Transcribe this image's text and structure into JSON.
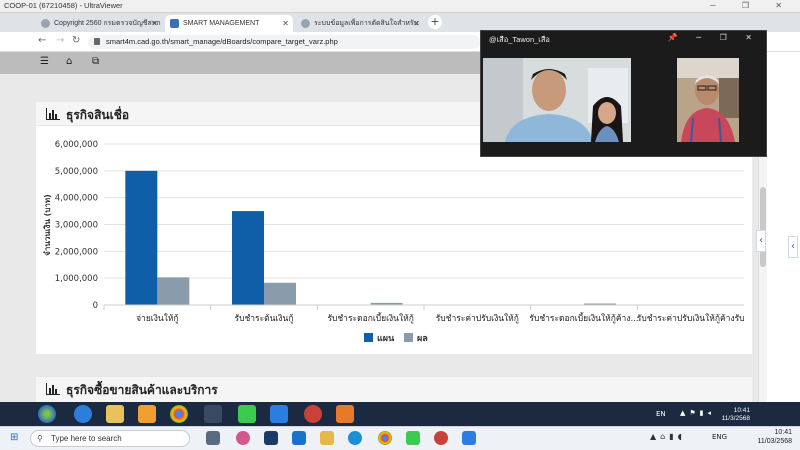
{
  "ultraviewer": {
    "title": "COOP-01 (67210458) - UltraViewer",
    "controls": "─ ❐ ✕"
  },
  "browser": {
    "tabs": [
      {
        "label": "Copyright 2560 กรมตรวจบัญชีสหก",
        "active": false
      },
      {
        "label": "SMART MANAGEMENT",
        "active": true
      },
      {
        "label": "ระบบข้อมูลเพื่อการตัดสินใจสำหรับ",
        "active": false
      }
    ],
    "new_tab": "+",
    "url": "smart4m.cad.go.th/smart_manage/dBoards/compare_target_varz.php"
  },
  "page": {
    "section1_title": "ธุรกิจสินเชื่อ",
    "section2_title": "ธุรกิจซื้อขายสินค้าและบริการ"
  },
  "video_call": {
    "title": "@เสือ_Tawon_เสือ",
    "controls": "📌 ─ ❐ ✕"
  },
  "chart_data": {
    "type": "bar",
    "title": "",
    "ylabel": "จำนวนเงิน (บาท)",
    "xlabel": "",
    "ylim": [
      0,
      6000000
    ],
    "yticks": [
      "0",
      "1,000,000",
      "2,000,000",
      "3,000,000",
      "4,000,000",
      "5,000,000",
      "6,000,000"
    ],
    "categories": [
      "จ่ายเงินให้กู้",
      "รับชำระต้นเงินกู้",
      "รับชำระดอกเบี้ยเงินให้กู้",
      "รับชำระค่าปรับเงินให้กู้",
      "รับชำระดอกเบี้ยเงินให้กู้ค้าง...",
      "รับชำระค่าปรับเงินให้กู้ค้างรับ"
    ],
    "series": [
      {
        "name": "แผน",
        "color": "#0f5fa8",
        "values": [
          5000000,
          3500000,
          0,
          0,
          0,
          0
        ]
      },
      {
        "name": "ผล",
        "color": "#8a9bab",
        "values": [
          1030000,
          830000,
          80000,
          0,
          20000,
          0
        ]
      }
    ],
    "legend": "bottom",
    "grid": true
  },
  "win_taskbar": {
    "lang": "EN",
    "time": "10:41",
    "date": "11/3/2568"
  },
  "host_taskbar": {
    "search_placeholder": "Type here to search",
    "lang": "ENG",
    "time": "10:41",
    "date": "11/03/2568"
  }
}
